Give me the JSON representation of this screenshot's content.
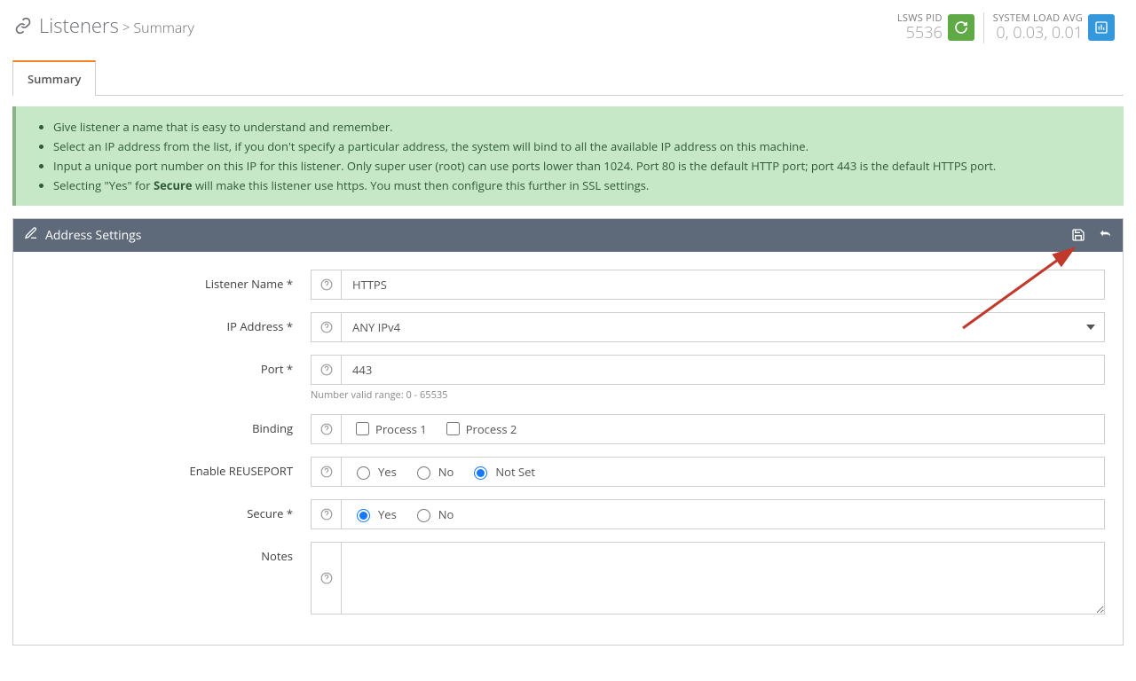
{
  "header": {
    "title": "Listeners",
    "separator": ">",
    "subtitle": "Summary"
  },
  "stats": {
    "pid": {
      "label": "LSWS PID",
      "value": "5536"
    },
    "load": {
      "label": "SYSTEM LOAD AVG",
      "value": "0, 0.03, 0.01"
    }
  },
  "tabs": {
    "summary": "Summary"
  },
  "info": {
    "line1": "Give listener a name that is easy to understand and remember.",
    "line2": "Select an IP address from the list, if you don't specify a particular address, the system will bind to all the available IP address on this machine.",
    "line3": "Input a unique port number on this IP for this listener. Only super user (root) can use ports lower than 1024. Port 80 is the default HTTP port; port 443 is the default HTTPS port.",
    "line4_pre": "Selecting \"Yes\" for ",
    "line4_bold": "Secure",
    "line4_post": " will make this listener use https. You must then configure this further in SSL settings."
  },
  "panel": {
    "title": "Address Settings"
  },
  "form": {
    "listener_name": {
      "label": "Listener Name *",
      "value": "HTTPS"
    },
    "ip_address": {
      "label": "IP Address *",
      "value": "ANY IPv4"
    },
    "port": {
      "label": "Port *",
      "value": "443",
      "hint": "Number valid range: 0 - 65535"
    },
    "binding": {
      "label": "Binding",
      "opt1": "Process 1",
      "opt2": "Process 2"
    },
    "reuseport": {
      "label": "Enable REUSEPORT",
      "yes": "Yes",
      "no": "No",
      "notset": "Not Set",
      "selected": "notset"
    },
    "secure": {
      "label": "Secure *",
      "yes": "Yes",
      "no": "No",
      "selected": "yes"
    },
    "notes": {
      "label": "Notes",
      "value": ""
    }
  }
}
